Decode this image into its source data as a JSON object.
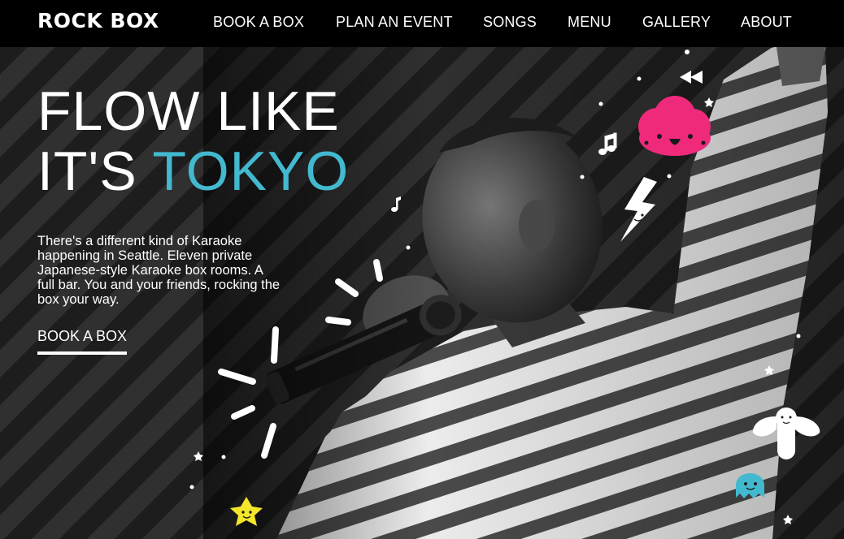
{
  "brand": {
    "logo_text": "ROCK BOX"
  },
  "nav": {
    "items": [
      {
        "label": "BOOK A BOX"
      },
      {
        "label": "PLAN AN EVENT"
      },
      {
        "label": "SONGS"
      },
      {
        "label": "MENU"
      },
      {
        "label": "GALLERY"
      },
      {
        "label": "ABOUT"
      }
    ]
  },
  "hero": {
    "headline_line1": "FLOW LIKE",
    "headline_line2_prefix": "IT'S ",
    "headline_line2_accent": "TOKYO",
    "intro_text": "There's a different kind of Karaoke happening in Seattle. Eleven private Japanese-style Karaoke box rooms. A full bar. You and your friends, rocking the box your way.",
    "cta_label": "BOOK A BOX"
  },
  "colors": {
    "accent": "#43b9cf",
    "cloud_pink": "#ef2a7b",
    "ghost_blue": "#43b9cf",
    "star_yellow": "#f4e62a",
    "background": "#000000"
  },
  "icons": [
    "rewind-icon",
    "music-note-icon",
    "lightning-icon",
    "cloud-character-icon",
    "angel-character-icon",
    "ghost-character-icon",
    "star-character-icon"
  ]
}
